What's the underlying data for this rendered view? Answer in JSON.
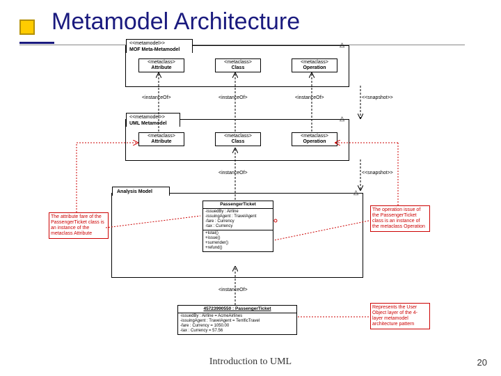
{
  "slide": {
    "title": "Metamodel Architecture",
    "footer": "Introduction to UML",
    "page": "20"
  },
  "packages": {
    "m3": {
      "stereo": "<<metamodel>>",
      "name": "MOF Meta-Metamodel"
    },
    "m2": {
      "stereo": "<<metamodel>>",
      "name": "UML Metamodel"
    },
    "m1": {
      "name": "Analysis Model"
    }
  },
  "metaclasses": {
    "m3_attr": {
      "stereo": "<metaclass>",
      "name": "Attribute"
    },
    "m3_class": {
      "stereo": "<metaclass>",
      "name": "Class"
    },
    "m3_op": {
      "stereo": "<metaclass>",
      "name": "Operation"
    },
    "m2_attr": {
      "stereo": "<metaclass>",
      "name": "Attribute"
    },
    "m2_class": {
      "stereo": "<metaclass>",
      "name": "Class"
    },
    "m2_op": {
      "stereo": "<metaclass>",
      "name": "Operation"
    }
  },
  "links": {
    "inst": "<instanceOf>",
    "snap": "<<snapshot>>"
  },
  "analysis_class": {
    "name": "PassengerTicket",
    "attrs": "-issuedBy : Airline\n-issuingAgent : TravelAgent\n-fare : Currency\n-tax : Currency",
    "ops": "+total()\n+issue()\n+surrender()\n+refund()"
  },
  "instance": {
    "name": "45723990550 : PassengerTicket",
    "slots": "-issuedBy : Airline = AcmeAirlines\n-issuingAgent : TravelAgent = TerrificTravel\n-fare : Currency = 1050.00\n-tax : Currency = 57.56"
  },
  "notes": {
    "left": "The attribute fare of the PassengerTicket class is an instance of the metaclass Attribute",
    "right_top": "The operation issue of the PassengerTicket class is an instance of the metaclass Operation",
    "right_bottom": "Represents the User Object layer of the 4-layer metamodel architecture pattern"
  }
}
